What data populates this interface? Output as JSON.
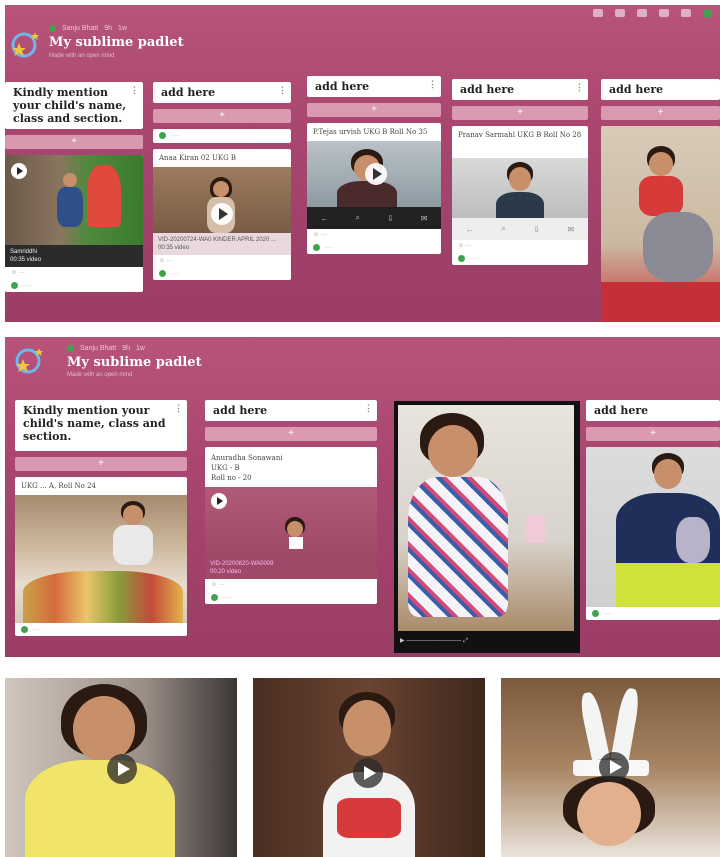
{
  "padlet": {
    "title": "My sublime padlet",
    "subtitle": "Made with an open mind",
    "breadcrumb": [
      "Sanju Bhatt",
      "9h",
      "1w"
    ]
  },
  "columns": {
    "intro": "Kindly mention your child's name, class and section.",
    "add_here": "add here"
  },
  "shot1": {
    "col1_card_caption": "Samriddhi",
    "col1_card_sub": "00:35 video",
    "col2_card_text": "Anaa Kiran 02 UKG B",
    "col2_caption": "VID-20200724-WA0 KINDER APRIL 2020 ... 00:35 video",
    "col3_card_text": "P.Tejas urvish UKG B Roll No 35",
    "col4_card_text": "Pranav Sarmahl UKG B Roll No 28"
  },
  "shot2": {
    "col1_card_text": "UKG ... A, Roll No 24",
    "col2_card_text_1": "Anuradha Sonawani",
    "col2_card_text_2": "UKG - B",
    "col2_card_text_3": "Roll no - 20",
    "col2_caption_1": "VID-20200820-WA0009",
    "col2_caption_2": "00:20 video"
  },
  "colors": {
    "accent": "#a84670",
    "avatar": "#3fa34d"
  },
  "icons": [
    "play-icon",
    "more-vertical-icon",
    "comment-avatar-icon",
    "heart-icon"
  ]
}
